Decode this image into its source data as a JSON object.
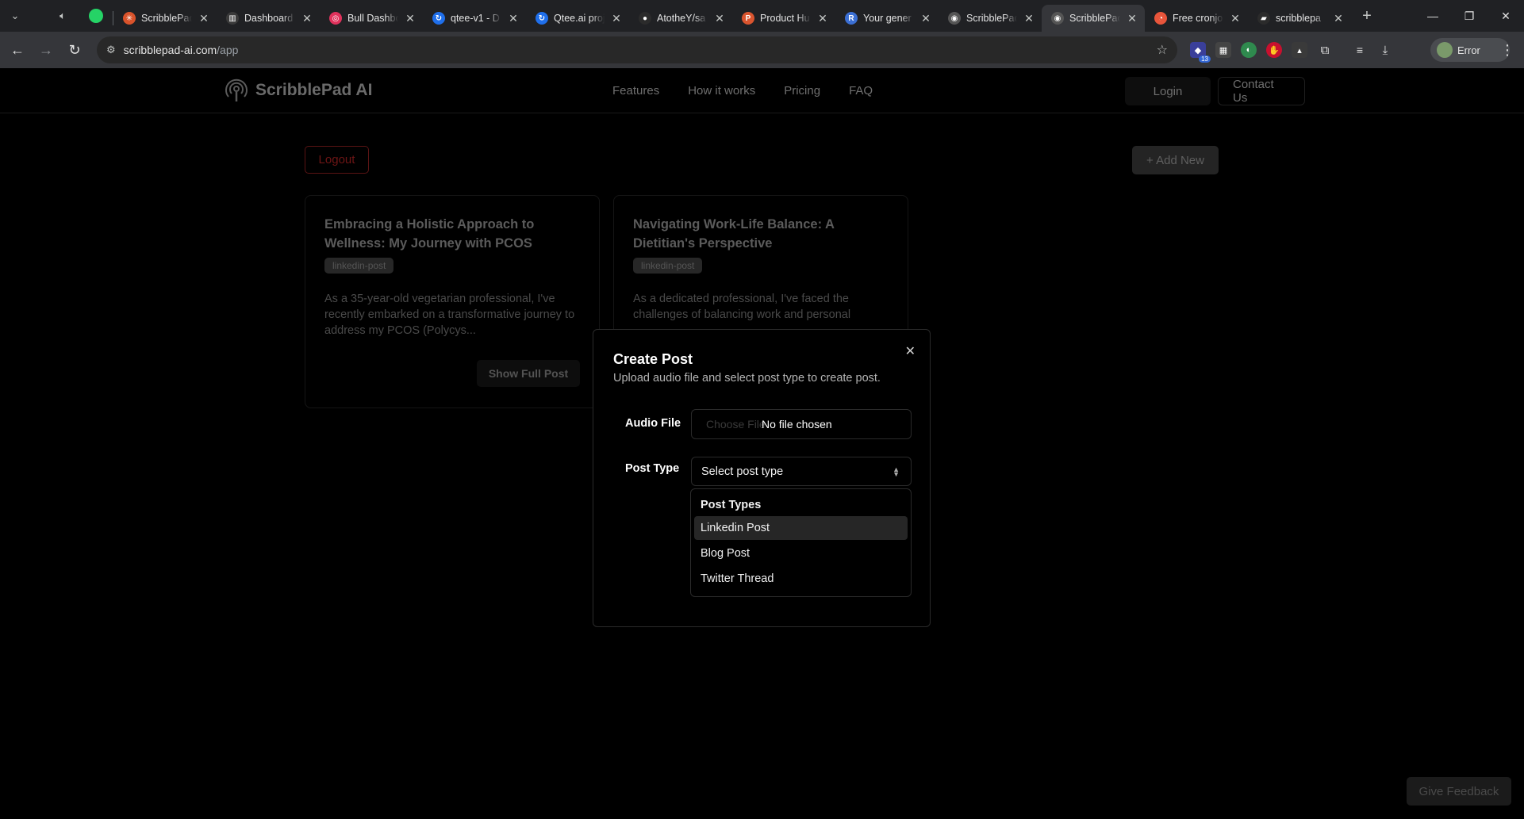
{
  "browser": {
    "tabs": [
      {
        "title": "ScribblePad",
        "favicon_color": "#d9532b",
        "favicon_glyph": "✳"
      },
      {
        "title": "Dashboard",
        "favicon_color": "#3a3a3a",
        "favicon_glyph": "▥"
      },
      {
        "title": "Bull Dashbo",
        "favicon_color": "#e0325c",
        "favicon_glyph": "◎"
      },
      {
        "title": "qtee-v1 - D",
        "favicon_color": "#1f6feb",
        "favicon_glyph": "↻"
      },
      {
        "title": "Qtee.ai proj",
        "favicon_color": "#1f6feb",
        "favicon_glyph": "↻"
      },
      {
        "title": "AtotheY/sa",
        "favicon_color": "#2b2b2b",
        "favicon_glyph": "●"
      },
      {
        "title": "Product Hu",
        "favicon_color": "#da552f",
        "favicon_glyph": "P"
      },
      {
        "title": "Your gener",
        "favicon_color": "#3b6fd4",
        "favicon_glyph": "R"
      },
      {
        "title": "ScribblePac",
        "favicon_color": "#555555",
        "favicon_glyph": "◉"
      },
      {
        "title": "ScribblePac",
        "favicon_color": "#555555",
        "favicon_glyph": "◉",
        "active": true
      },
      {
        "title": "Free cronjo",
        "favicon_color": "#e8553b",
        "favicon_glyph": "◔"
      },
      {
        "title": "scribblepa",
        "favicon_color": "#2b2b2b",
        "favicon_glyph": "▰"
      }
    ],
    "url_host": "scribblepad-ai.com",
    "url_path": "/app",
    "extension_badge": "13",
    "profile_label": "Error"
  },
  "site": {
    "brand": "ScribblePad AI",
    "nav": [
      "Features",
      "How it works",
      "Pricing",
      "FAQ"
    ],
    "login_label": "Login",
    "contact_label": "Contact Us",
    "logout_label": "Logout",
    "add_new_label": "+ Add New",
    "feedback_label": "Give Feedback"
  },
  "posts": [
    {
      "title": "Embracing a Holistic Approach to Wellness: My Journey with PCOS",
      "tag": "linkedin-post",
      "excerpt": "As a 35-year-old vegetarian professional, I've recently embarked on a transformative journey to address my PCOS (Polycys...",
      "button": "Show Full Post"
    },
    {
      "title": "Navigating Work-Life Balance: A Dietitian's Perspective",
      "tag": "linkedin-post",
      "excerpt": "As a dedicated professional, I've faced the challenges of balancing work and personal",
      "button": ""
    }
  ],
  "modal": {
    "title": "Create Post",
    "description": "Upload audio file and select post type to create post.",
    "audio_label": "Audio File",
    "choose_file_label": "Choose File",
    "no_file_label": "No file chosen",
    "post_type_label": "Post Type",
    "select_placeholder": "Select post type"
  },
  "dropdown": {
    "group_label": "Post Types",
    "options": [
      "Linkedin Post",
      "Blog Post",
      "Twitter Thread"
    ],
    "highlighted_index": 0
  }
}
